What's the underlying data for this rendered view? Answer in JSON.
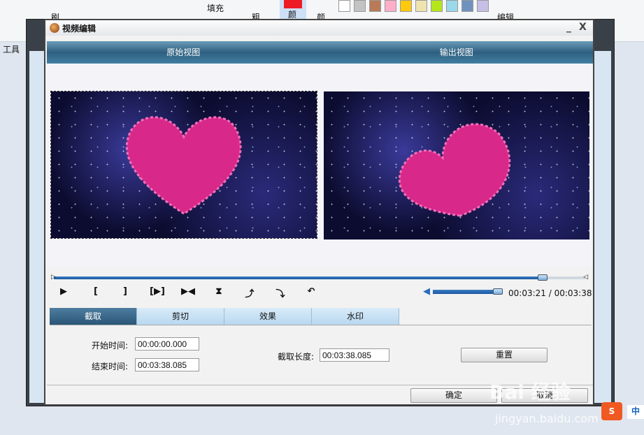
{
  "background_app": {
    "ribbon_labels": {
      "fill": "填充",
      "tools": "工具",
      "size": "粗",
      "color1": "颜",
      "color2": "颜",
      "edit": "编辑",
      "brush": "刷"
    },
    "swatches": [
      "#ffffff",
      "#c3c3c3",
      "#b97a57",
      "#ffaec9",
      "#ffc90e",
      "#efe4b0",
      "#b5e61d",
      "#99d9ea",
      "#7092be",
      "#c8bfe7"
    ],
    "color1_value": "#ed1c24"
  },
  "dialog": {
    "title": "视频编辑",
    "minimize": "_",
    "close": "X",
    "views": {
      "original": "原始视图",
      "output": "输出视图"
    },
    "seek": {
      "progress": 0.92
    },
    "toolbar": [
      {
        "icon": "play-icon",
        "glyph": "▶"
      },
      {
        "icon": "mark-in-icon",
        "glyph": "["
      },
      {
        "icon": "mark-out-icon",
        "glyph": "]"
      },
      {
        "icon": "play-selection-icon",
        "glyph": "[▶]"
      },
      {
        "icon": "goto-icon",
        "glyph": "▶◀"
      },
      {
        "icon": "flip-vertical-icon",
        "glyph": "⧗"
      },
      {
        "icon": "rotate-right-icon",
        "glyph": "⤴"
      },
      {
        "icon": "rotate-left-icon",
        "glyph": "⤵"
      },
      {
        "icon": "undo-icon",
        "glyph": "↶"
      }
    ],
    "volume": {
      "level": 1.0
    },
    "time": "00:03:21 / 00:03:38",
    "tabs": [
      "截取",
      "剪切",
      "效果",
      "水印"
    ],
    "active_tab": 0,
    "form": {
      "start_label": "开始时间:",
      "start_value": "00:00:00.000",
      "end_label": "结束时间:",
      "end_value": "00:03:38.085",
      "length_label": "截取长度:",
      "length_value": "00:03:38.085",
      "reset": "重置"
    },
    "ok": "确定",
    "cancel": "取消"
  },
  "watermark": {
    "text": "Bai 经验",
    "url": "jingyan.baidu.com"
  },
  "taskbar": {
    "ime": "S",
    "lang": "中"
  }
}
